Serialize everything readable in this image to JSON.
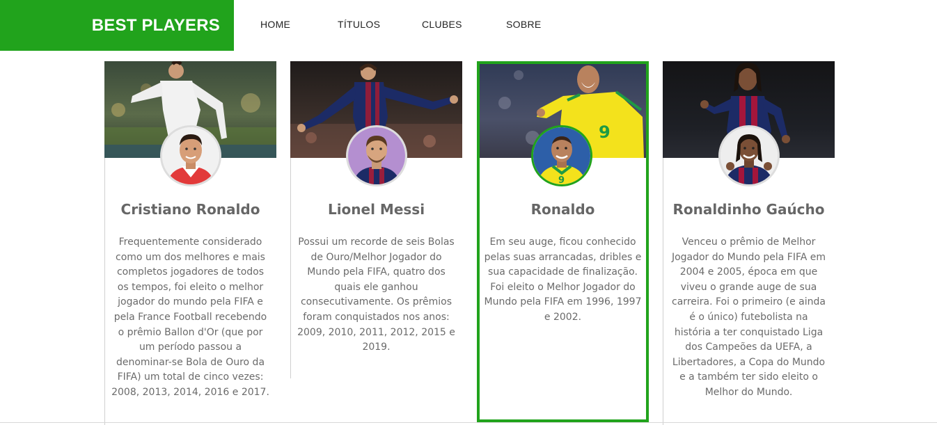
{
  "brand": {
    "logo": "BEST PLAYERS",
    "accent": "#21a31c"
  },
  "nav": [
    {
      "label": "HOME"
    },
    {
      "label": "TÍTULOS"
    },
    {
      "label": "CLUBES"
    },
    {
      "label": "SOBRE"
    }
  ],
  "cards": [
    {
      "name": "Cristiano Ronaldo",
      "description": "Frequentemente considerado como um dos melhores e mais completos jogadores de todos os tempos, foi eleito o melhor jogador do mundo pela FIFA e pela France Football recebendo o prêmio Ballon d'Or (que por um período passou a denominar-se Bola de Ouro da FIFA) um total de cinco vezes: 2008, 2013, 2014, 2016 e 2017.",
      "banner_image": "cristiano-ronaldo-real-madrid-photo",
      "avatar_image": "cristiano-ronaldo-portrait"
    },
    {
      "name": "Lionel Messi",
      "description": "Possui um recorde de seis Bolas de Ouro/Melhor Jogador do Mundo pela FIFA, quatro dos quais ele ganhou consecutivamente. Os prêmios foram conquistados nos anos: 2009, 2010, 2011, 2012, 2015 e 2019.",
      "banner_image": "lionel-messi-barcelona-photo",
      "avatar_image": "lionel-messi-portrait"
    },
    {
      "name": "Ronaldo",
      "description": "Em seu auge, ficou conhecido pelas suas arrancadas, dribles e sua capacidade de finalização. Foi eleito o Melhor Jogador do Mundo pela FIFA em 1996, 1997 e 2002.",
      "banner_image": "ronaldo-brazil-photo",
      "avatar_image": "ronaldo-portrait"
    },
    {
      "name": "Ronaldinho Gaúcho",
      "description": "Venceu o prêmio de Melhor Jogador do Mundo pela FIFA em 2004 e 2005, época em que viveu o grande auge de sua carreira. Foi o primeiro (e ainda é o único) futebolista na história a ter conquistado Liga dos Campeões da UEFA, a Libertadores, a Copa do Mundo e a também ter sido eleito o Melhor do Mundo.",
      "banner_image": "ronaldinho-barcelona-photo",
      "avatar_image": "ronaldinho-portrait"
    }
  ]
}
